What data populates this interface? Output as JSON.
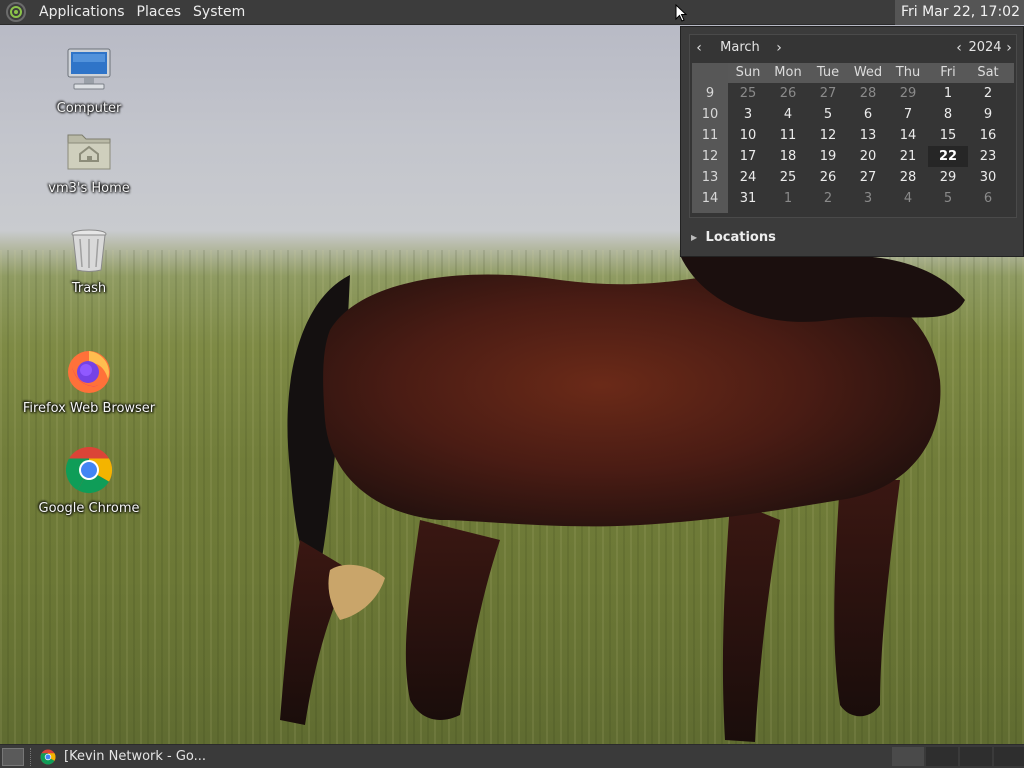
{
  "top_panel": {
    "menus": [
      "Applications",
      "Places",
      "System"
    ],
    "clock": "Fri Mar 22, 17:02"
  },
  "calendar": {
    "month": "March",
    "year": "2024",
    "weekday_headers": [
      "Sun",
      "Mon",
      "Tue",
      "Wed",
      "Thu",
      "Fri",
      "Sat"
    ],
    "weeks": [
      {
        "week": "9",
        "days": [
          "25",
          "26",
          "27",
          "28",
          "29",
          "1",
          "2"
        ],
        "dim": [
          true,
          true,
          true,
          true,
          true,
          false,
          false
        ]
      },
      {
        "week": "10",
        "days": [
          "3",
          "4",
          "5",
          "6",
          "7",
          "8",
          "9"
        ],
        "dim": [
          false,
          false,
          false,
          false,
          false,
          false,
          false
        ]
      },
      {
        "week": "11",
        "days": [
          "10",
          "11",
          "12",
          "13",
          "14",
          "15",
          "16"
        ],
        "dim": [
          false,
          false,
          false,
          false,
          false,
          false,
          false
        ]
      },
      {
        "week": "12",
        "days": [
          "17",
          "18",
          "19",
          "20",
          "21",
          "22",
          "23"
        ],
        "dim": [
          false,
          false,
          false,
          false,
          false,
          false,
          false
        ]
      },
      {
        "week": "13",
        "days": [
          "24",
          "25",
          "26",
          "27",
          "28",
          "29",
          "30"
        ],
        "dim": [
          false,
          false,
          false,
          false,
          false,
          false,
          false
        ]
      },
      {
        "week": "14",
        "days": [
          "31",
          "1",
          "2",
          "3",
          "4",
          "5",
          "6"
        ],
        "dim": [
          false,
          true,
          true,
          true,
          true,
          true,
          true
        ]
      }
    ],
    "today": "22",
    "locations_label": "Locations"
  },
  "desktop_icons": [
    {
      "label": "Computer",
      "icon": "computer-icon"
    },
    {
      "label": "vm3's Home",
      "icon": "home-folder-icon"
    },
    {
      "label": "Trash",
      "icon": "trash-icon"
    },
    {
      "label": "Firefox Web Browser",
      "icon": "firefox-icon"
    },
    {
      "label": "Google Chrome",
      "icon": "chrome-icon"
    }
  ],
  "taskbar": {
    "task_label": "[Kevin Network - Go..."
  },
  "colors": {
    "panel_bg": "#3c3c3c",
    "calendar_today_bg": "#262626",
    "wallpaper_sky": "#c3c5cc",
    "wallpaper_grass": "#717d3a"
  }
}
